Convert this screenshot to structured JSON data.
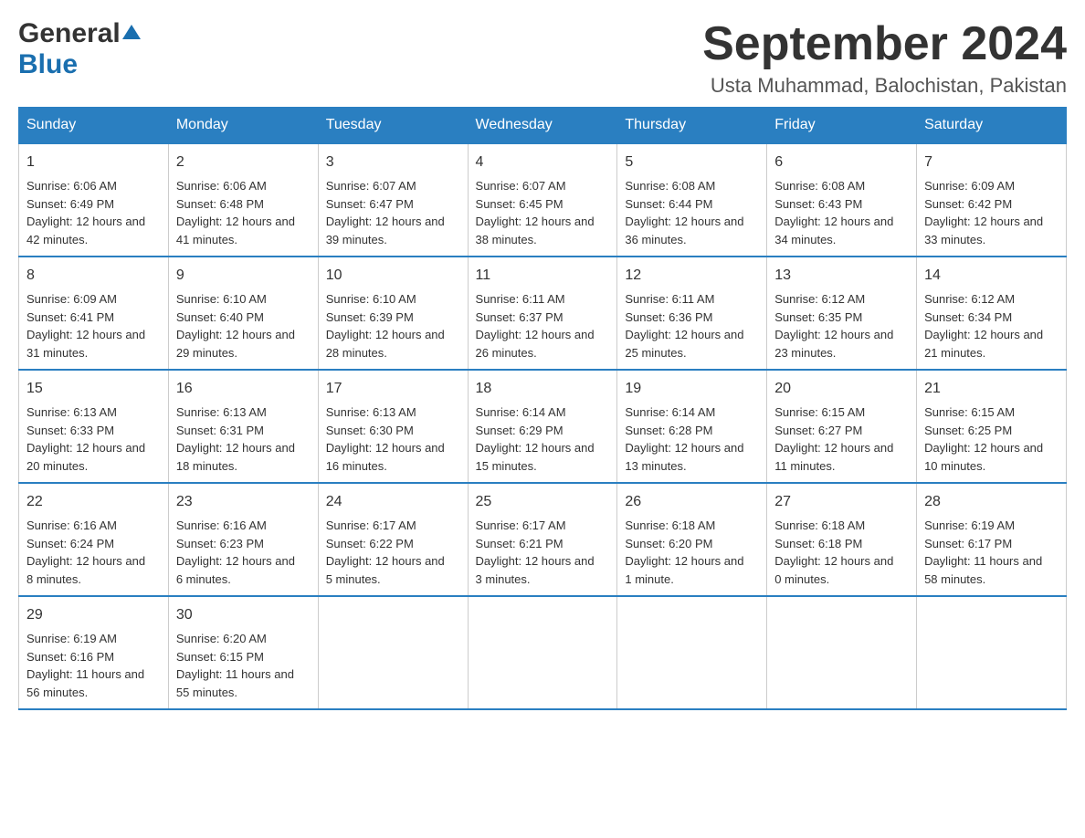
{
  "logo": {
    "general": "General",
    "blue": "Blue"
  },
  "title": {
    "month": "September 2024",
    "location": "Usta Muhammad, Balochistan, Pakistan"
  },
  "weekdays": [
    "Sunday",
    "Monday",
    "Tuesday",
    "Wednesday",
    "Thursday",
    "Friday",
    "Saturday"
  ],
  "weeks": [
    [
      {
        "day": "1",
        "sunrise": "6:06 AM",
        "sunset": "6:49 PM",
        "daylight": "12 hours and 42 minutes."
      },
      {
        "day": "2",
        "sunrise": "6:06 AM",
        "sunset": "6:48 PM",
        "daylight": "12 hours and 41 minutes."
      },
      {
        "day": "3",
        "sunrise": "6:07 AM",
        "sunset": "6:47 PM",
        "daylight": "12 hours and 39 minutes."
      },
      {
        "day": "4",
        "sunrise": "6:07 AM",
        "sunset": "6:45 PM",
        "daylight": "12 hours and 38 minutes."
      },
      {
        "day": "5",
        "sunrise": "6:08 AM",
        "sunset": "6:44 PM",
        "daylight": "12 hours and 36 minutes."
      },
      {
        "day": "6",
        "sunrise": "6:08 AM",
        "sunset": "6:43 PM",
        "daylight": "12 hours and 34 minutes."
      },
      {
        "day": "7",
        "sunrise": "6:09 AM",
        "sunset": "6:42 PM",
        "daylight": "12 hours and 33 minutes."
      }
    ],
    [
      {
        "day": "8",
        "sunrise": "6:09 AM",
        "sunset": "6:41 PM",
        "daylight": "12 hours and 31 minutes."
      },
      {
        "day": "9",
        "sunrise": "6:10 AM",
        "sunset": "6:40 PM",
        "daylight": "12 hours and 29 minutes."
      },
      {
        "day": "10",
        "sunrise": "6:10 AM",
        "sunset": "6:39 PM",
        "daylight": "12 hours and 28 minutes."
      },
      {
        "day": "11",
        "sunrise": "6:11 AM",
        "sunset": "6:37 PM",
        "daylight": "12 hours and 26 minutes."
      },
      {
        "day": "12",
        "sunrise": "6:11 AM",
        "sunset": "6:36 PM",
        "daylight": "12 hours and 25 minutes."
      },
      {
        "day": "13",
        "sunrise": "6:12 AM",
        "sunset": "6:35 PM",
        "daylight": "12 hours and 23 minutes."
      },
      {
        "day": "14",
        "sunrise": "6:12 AM",
        "sunset": "6:34 PM",
        "daylight": "12 hours and 21 minutes."
      }
    ],
    [
      {
        "day": "15",
        "sunrise": "6:13 AM",
        "sunset": "6:33 PM",
        "daylight": "12 hours and 20 minutes."
      },
      {
        "day": "16",
        "sunrise": "6:13 AM",
        "sunset": "6:31 PM",
        "daylight": "12 hours and 18 minutes."
      },
      {
        "day": "17",
        "sunrise": "6:13 AM",
        "sunset": "6:30 PM",
        "daylight": "12 hours and 16 minutes."
      },
      {
        "day": "18",
        "sunrise": "6:14 AM",
        "sunset": "6:29 PM",
        "daylight": "12 hours and 15 minutes."
      },
      {
        "day": "19",
        "sunrise": "6:14 AM",
        "sunset": "6:28 PM",
        "daylight": "12 hours and 13 minutes."
      },
      {
        "day": "20",
        "sunrise": "6:15 AM",
        "sunset": "6:27 PM",
        "daylight": "12 hours and 11 minutes."
      },
      {
        "day": "21",
        "sunrise": "6:15 AM",
        "sunset": "6:25 PM",
        "daylight": "12 hours and 10 minutes."
      }
    ],
    [
      {
        "day": "22",
        "sunrise": "6:16 AM",
        "sunset": "6:24 PM",
        "daylight": "12 hours and 8 minutes."
      },
      {
        "day": "23",
        "sunrise": "6:16 AM",
        "sunset": "6:23 PM",
        "daylight": "12 hours and 6 minutes."
      },
      {
        "day": "24",
        "sunrise": "6:17 AM",
        "sunset": "6:22 PM",
        "daylight": "12 hours and 5 minutes."
      },
      {
        "day": "25",
        "sunrise": "6:17 AM",
        "sunset": "6:21 PM",
        "daylight": "12 hours and 3 minutes."
      },
      {
        "day": "26",
        "sunrise": "6:18 AM",
        "sunset": "6:20 PM",
        "daylight": "12 hours and 1 minute."
      },
      {
        "day": "27",
        "sunrise": "6:18 AM",
        "sunset": "6:18 PM",
        "daylight": "12 hours and 0 minutes."
      },
      {
        "day": "28",
        "sunrise": "6:19 AM",
        "sunset": "6:17 PM",
        "daylight": "11 hours and 58 minutes."
      }
    ],
    [
      {
        "day": "29",
        "sunrise": "6:19 AM",
        "sunset": "6:16 PM",
        "daylight": "11 hours and 56 minutes."
      },
      {
        "day": "30",
        "sunrise": "6:20 AM",
        "sunset": "6:15 PM",
        "daylight": "11 hours and 55 minutes."
      },
      null,
      null,
      null,
      null,
      null
    ]
  ],
  "labels": {
    "sunrise": "Sunrise:",
    "sunset": "Sunset:",
    "daylight": "Daylight:"
  }
}
